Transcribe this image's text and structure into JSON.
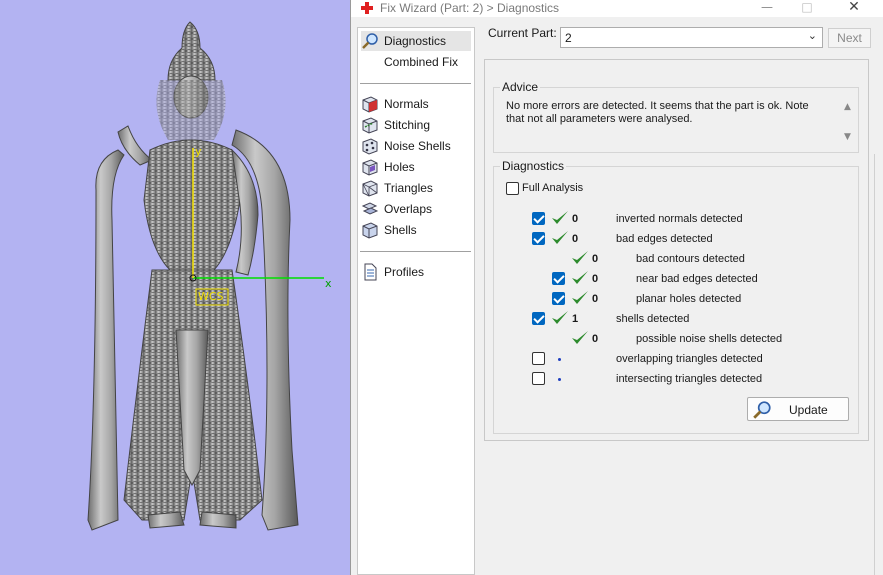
{
  "window": {
    "title": "Fix Wizard (Part: 2) > Diagnostics",
    "minimize_glyph": "—",
    "maximize_glyph": "□",
    "close_glyph": "✕"
  },
  "viewport": {
    "axis_x": "x",
    "axis_y": "y",
    "wcs_label": "WCS",
    "colors": {
      "background": "#b3b3f2",
      "x_axis": "#00e000",
      "y_axis": "#f2e000",
      "model": "#a8a8a8"
    }
  },
  "nav": {
    "items": [
      {
        "label": "Diagnostics",
        "icon": "magnifier-icon"
      },
      {
        "label": "Combined Fix",
        "icon": "blank-icon"
      },
      {
        "label": "Normals",
        "icon": "normals-cube-icon"
      },
      {
        "label": "Stitching",
        "icon": "stitching-cube-icon"
      },
      {
        "label": "Noise Shells",
        "icon": "noise-shells-icon"
      },
      {
        "label": "Holes",
        "icon": "holes-cube-icon"
      },
      {
        "label": "Triangles",
        "icon": "triangles-cube-icon"
      },
      {
        "label": "Overlaps",
        "icon": "overlaps-icon"
      },
      {
        "label": "Shells",
        "icon": "shells-cube-icon"
      },
      {
        "label": "Profiles",
        "icon": "document-icon"
      }
    ]
  },
  "header": {
    "current_part_label": "Current Part:",
    "current_part_value": "2",
    "next_label": "Next"
  },
  "advice": {
    "title": "Advice",
    "text": "No more errors are detected. It seems that the part is ok. Note that not all parameters were analysed."
  },
  "diagnostics": {
    "title": "Diagnostics",
    "full_analysis_label": "Full Analysis",
    "full_analysis_checked": false,
    "rows": [
      {
        "checked": true,
        "has_checkbox": true,
        "status": "ok",
        "count": "0",
        "label": "inverted normals detected",
        "indent": 0
      },
      {
        "checked": true,
        "has_checkbox": true,
        "status": "ok",
        "count": "0",
        "label": "bad edges detected",
        "indent": 0
      },
      {
        "checked": false,
        "has_checkbox": false,
        "status": "ok",
        "count": "0",
        "label": "bad contours detected",
        "indent": 1
      },
      {
        "checked": true,
        "has_checkbox": true,
        "status": "ok",
        "count": "0",
        "label": "near bad edges detected",
        "indent": 1
      },
      {
        "checked": true,
        "has_checkbox": true,
        "status": "ok",
        "count": "0",
        "label": "planar holes detected",
        "indent": 1
      },
      {
        "checked": true,
        "has_checkbox": true,
        "status": "ok",
        "count": "1",
        "label": "shells detected",
        "indent": 0
      },
      {
        "checked": false,
        "has_checkbox": false,
        "status": "ok",
        "count": "0",
        "label": "possible noise shells detected",
        "indent": 1
      },
      {
        "checked": false,
        "has_checkbox": true,
        "status": "pending",
        "count": "",
        "label": "overlapping triangles detected",
        "indent": 0
      },
      {
        "checked": false,
        "has_checkbox": true,
        "status": "pending",
        "count": "",
        "label": "intersecting triangles detected",
        "indent": 0
      }
    ],
    "update_label": "Update"
  },
  "colors": {
    "check_green": "#2e8b2e",
    "checkbox_blue": "#0067c0",
    "title_red": "#e02020"
  }
}
